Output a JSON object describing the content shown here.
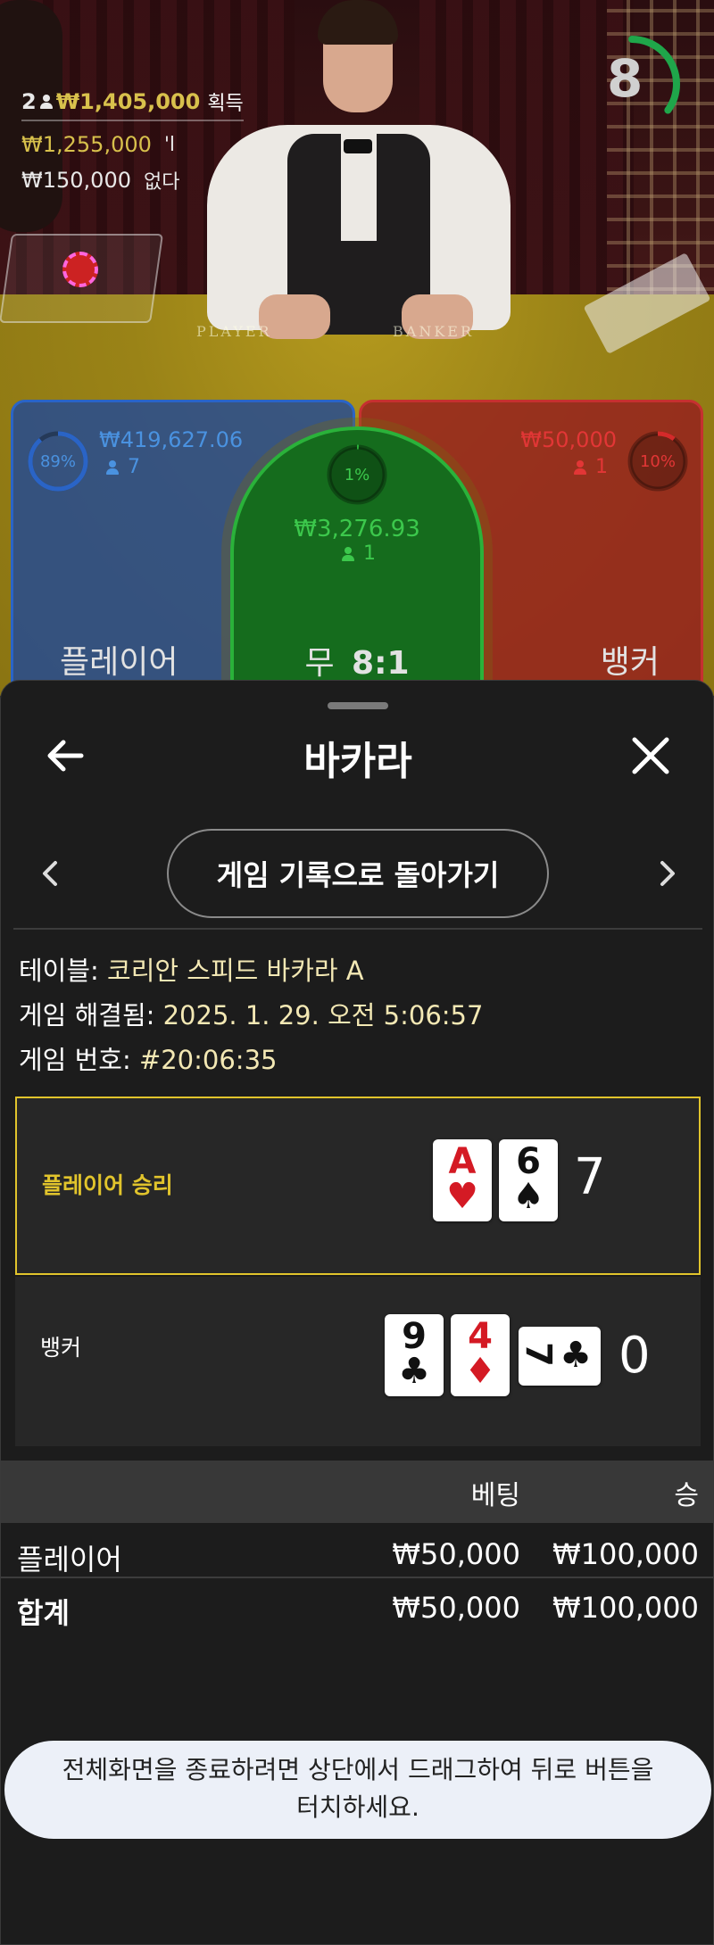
{
  "stats": {
    "players": "2",
    "total_won": "₩1,405,000",
    "won_label": "획득",
    "bet_amount": "₩1,255,000",
    "bet_suffix": "'l",
    "none_amount": "₩150,000",
    "none_label": "없다"
  },
  "felt": {
    "player_word": "PLAYER",
    "banker_word": "BANKER"
  },
  "countdown": {
    "value": "8",
    "fraction": 0.35,
    "color": "#1fa64a"
  },
  "bet_zones": {
    "player": {
      "percent": "89%",
      "percent_value": 0.89,
      "amount": "₩419,627.06",
      "bettors": "7",
      "label": "플레이어",
      "color": "#2a64c6"
    },
    "tie": {
      "percent": "1%",
      "percent_value": 0.01,
      "amount": "₩3,276.93",
      "bettors": "1",
      "label": "무",
      "payout": "8:1",
      "color": "#2ab23a"
    },
    "banker": {
      "percent": "10%",
      "percent_value": 0.1,
      "amount": "₩50,000",
      "bettors": "1",
      "label": "뱅커",
      "color": "#d42a2a"
    }
  },
  "sheet": {
    "title": "바카라",
    "back_to_history": "게임 기록으로 돌아가기",
    "table_label": "테이블:",
    "table_value": "코리안 스피드 바카라 A",
    "resolved_label": "게임 해결됨:",
    "resolved_value": "2025. 1. 29. 오전 5:06:57",
    "game_no_label": "게임 번호:",
    "game_no_value": "#20:06:35"
  },
  "results": {
    "player": {
      "label": "플레이어 승리",
      "label_color": "#e1c42c",
      "cards": [
        {
          "rank": "A",
          "suit": "♥",
          "color": "red"
        },
        {
          "rank": "6",
          "suit": "♠",
          "color": "black"
        }
      ],
      "score": "7"
    },
    "banker": {
      "label": "뱅커",
      "cards": [
        {
          "rank": "9",
          "suit": "♣",
          "color": "black"
        },
        {
          "rank": "4",
          "suit": "♦",
          "color": "red"
        },
        {
          "rank": "7",
          "suit": "♣",
          "color": "black",
          "rotated": true
        }
      ],
      "score": "0"
    }
  },
  "bets_table": {
    "headers": {
      "bet": "베팅",
      "win": "승"
    },
    "rows": [
      {
        "name": "플레이어",
        "bet": "₩50,000",
        "win": "₩100,000"
      }
    ],
    "total": {
      "name": "합계",
      "bet": "₩50,000",
      "win": "₩100,000"
    }
  },
  "toast": {
    "line1": "전체화면을 종료하려면 상단에서 드래그하여 뒤로 버튼을",
    "line2": "터치하세요."
  }
}
